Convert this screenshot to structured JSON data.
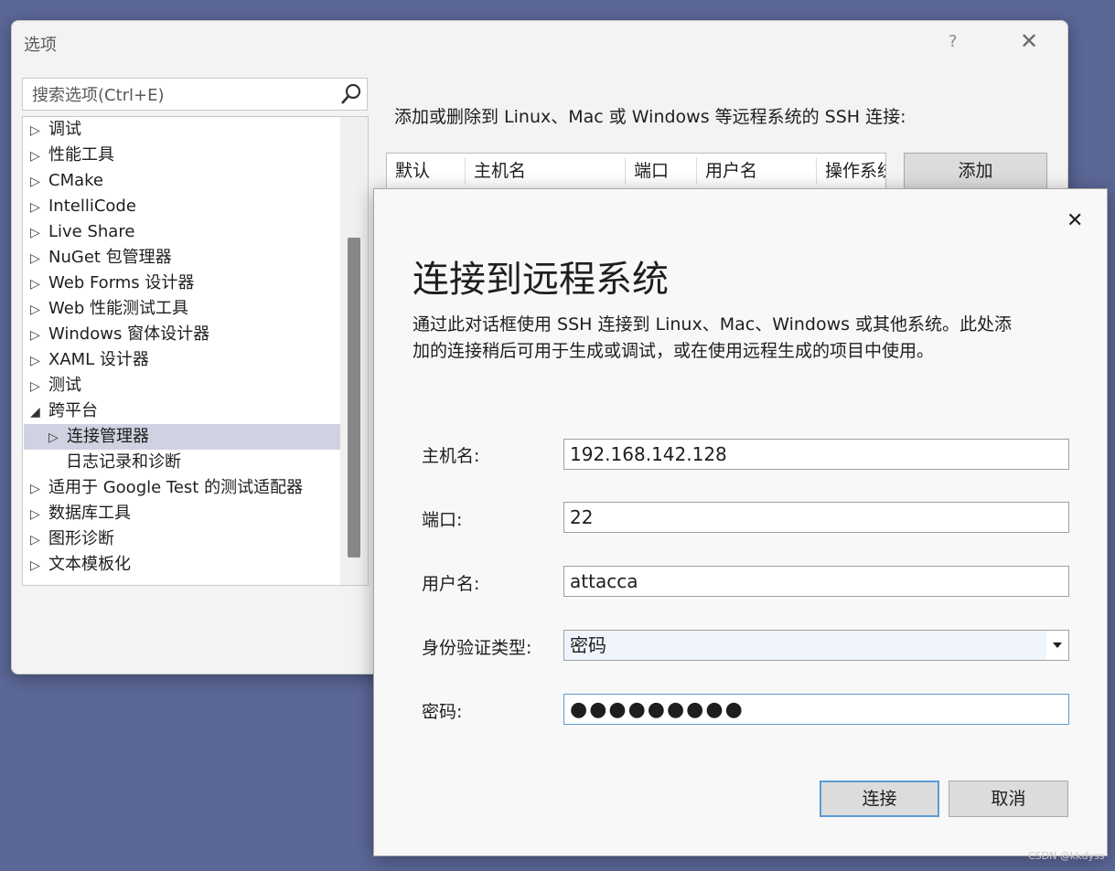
{
  "options": {
    "title": "选项",
    "help_glyph": "?",
    "close_glyph": "✕",
    "search_placeholder": "搜索选项(Ctrl+E)",
    "tree": [
      {
        "label": "调试",
        "arrow": "▷"
      },
      {
        "label": "性能工具",
        "arrow": "▷"
      },
      {
        "label": "CMake",
        "arrow": "▷"
      },
      {
        "label": "IntelliCode",
        "arrow": "▷"
      },
      {
        "label": "Live Share",
        "arrow": "▷"
      },
      {
        "label": "NuGet 包管理器",
        "arrow": "▷"
      },
      {
        "label": "Web Forms 设计器",
        "arrow": "▷"
      },
      {
        "label": "Web 性能测试工具",
        "arrow": "▷"
      },
      {
        "label": "Windows 窗体设计器",
        "arrow": "▷"
      },
      {
        "label": "XAML 设计器",
        "arrow": "▷"
      },
      {
        "label": "测试",
        "arrow": "▷"
      },
      {
        "label": "跨平台",
        "arrow": "◢"
      },
      {
        "label": "连接管理器",
        "arrow": "▷"
      },
      {
        "label": "日志记录和诊断",
        "arrow": ""
      },
      {
        "label": "适用于 Google Test 的测试适配器",
        "arrow": "▷"
      },
      {
        "label": "数据库工具",
        "arrow": "▷"
      },
      {
        "label": "图形诊断",
        "arrow": "▷"
      },
      {
        "label": "文本模板化",
        "arrow": "▷"
      }
    ],
    "ssh_description": "添加或删除到 Linux、Mac 或 Windows 等远程系统的 SSH 连接:",
    "table_headers": [
      "默认",
      "主机名",
      "端口",
      "用户名",
      "操作系统"
    ],
    "add_label": "添加"
  },
  "connect_dialog": {
    "close_glyph": "✕",
    "title": "连接到远程系统",
    "description_line1": "通过此对话框使用 SSH 连接到 Linux、Mac、Windows 或其他系统。此处添",
    "description_line2": "加的连接稍后可用于生成或调试，或在使用远程生成的项目中使用。",
    "fields": {
      "host_label": "主机名:",
      "host_value": "192.168.142.128",
      "port_label": "端口:",
      "port_value": "22",
      "user_label": "用户名:",
      "user_value": "attacca",
      "auth_label": "身份验证类型:",
      "auth_value": "密码",
      "password_label": "密码:",
      "password_value": "●●●●●●●●●"
    },
    "connect_label": "连接",
    "cancel_label": "取消"
  },
  "watermark": "CSDN @kkdyss",
  "colors": {
    "desktop": "#5b6797",
    "selection": "#d0d2e2",
    "focus_border": "#5b9bd5"
  }
}
